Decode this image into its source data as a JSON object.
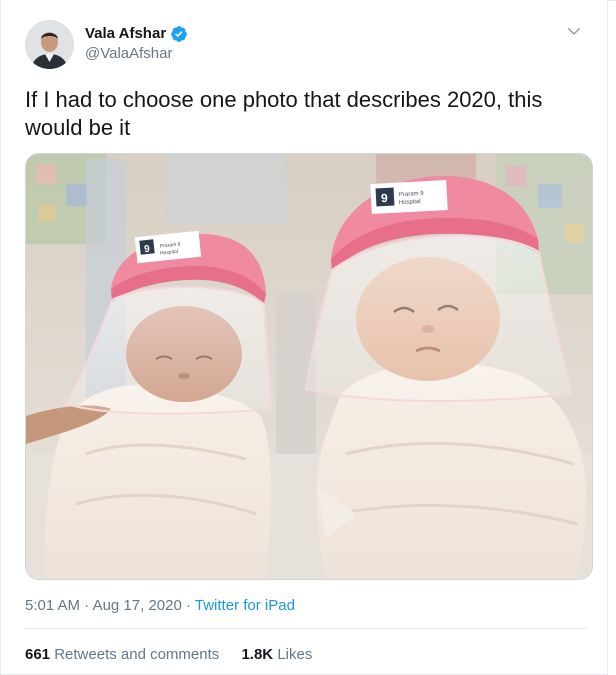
{
  "tweet": {
    "author": {
      "display_name": "Vala Afshar",
      "handle": "@ValaAfshar",
      "verified": true
    },
    "text": "If I had to choose one photo that describes 2020, this would be it",
    "meta": {
      "time": "5:01 AM",
      "separator1": "·",
      "date": "Aug 17, 2020",
      "separator2": "·",
      "source": "Twitter for iPad"
    },
    "stats": {
      "retweets_count": "661",
      "retweets_label": "Retweets and comments",
      "likes_count": "1.8K",
      "likes_label": "Likes"
    },
    "media": {
      "shield_logo_number": "9",
      "shield_brand_line1": "Praram 9",
      "shield_brand_line2": "Hospital"
    }
  },
  "colors": {
    "link": "#1b95e0",
    "verified": "#1da1f2",
    "secondary_text": "#657786",
    "primary_text": "#14171a",
    "border": "#e6ecf0"
  },
  "icons": [
    "verified-badge-icon",
    "chevron-down-icon"
  ]
}
